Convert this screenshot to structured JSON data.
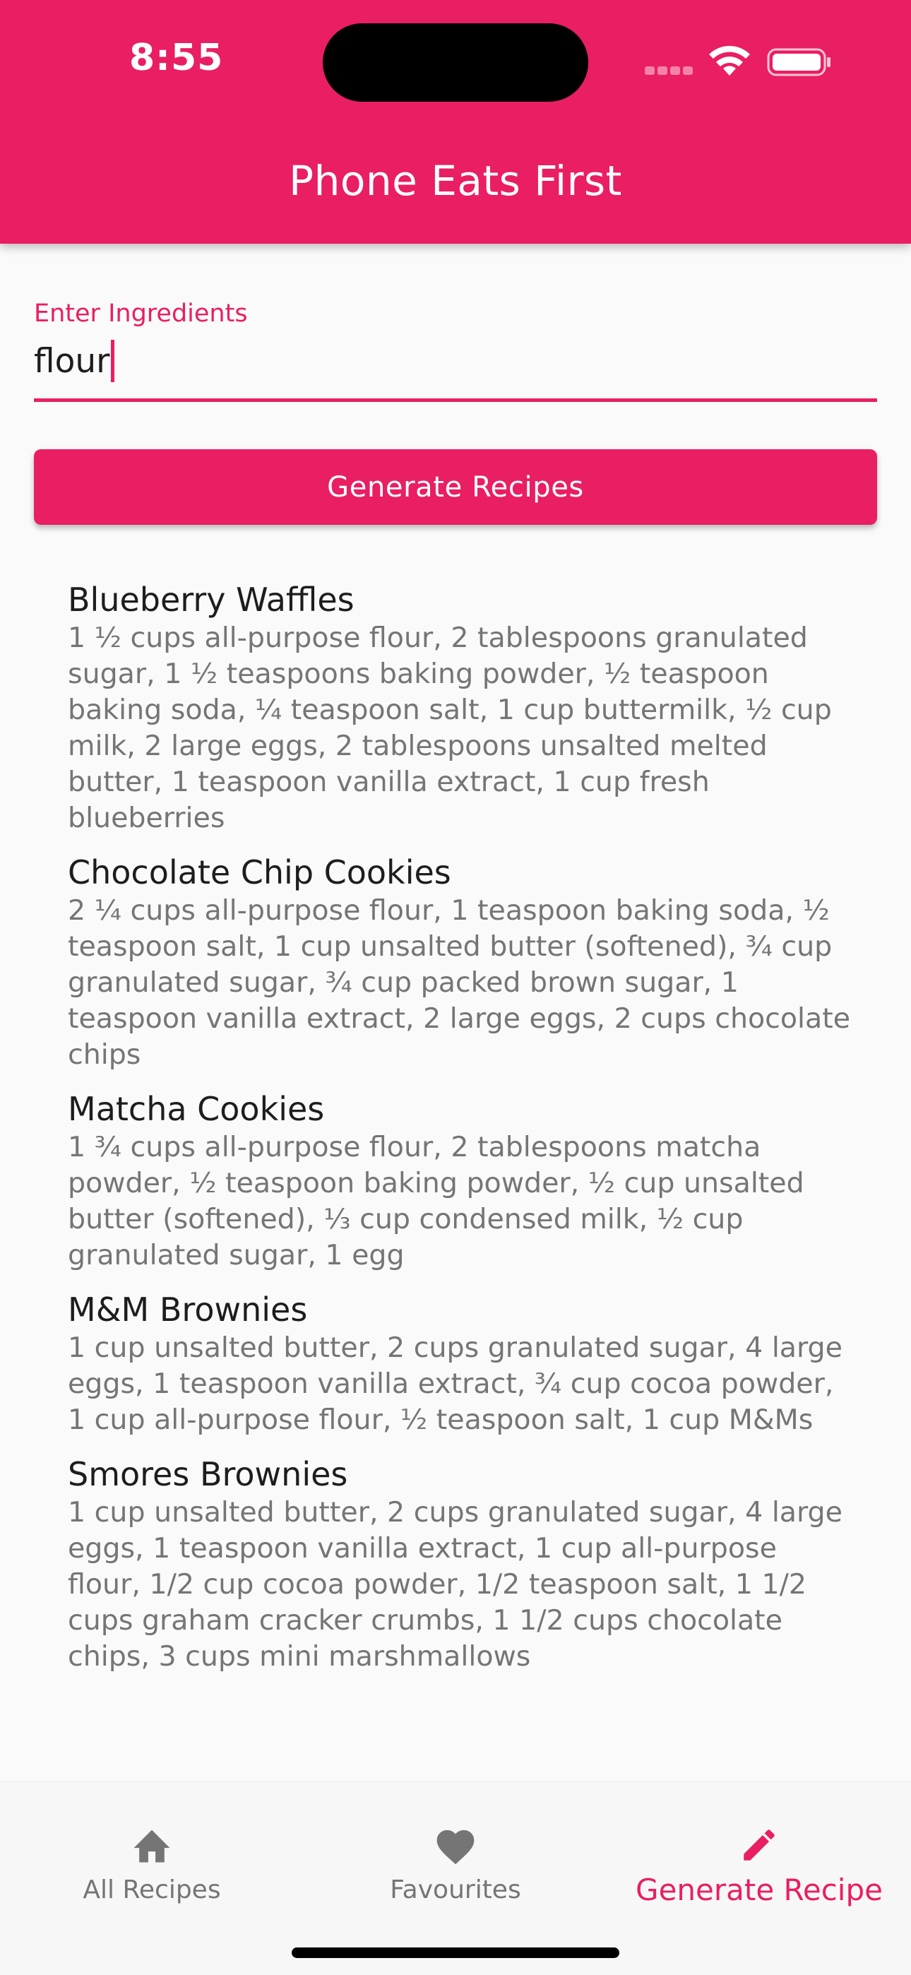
{
  "status_bar": {
    "time": "8:55"
  },
  "app": {
    "title": "Phone Eats First",
    "accent_color": "#e91e63"
  },
  "ingredients_field": {
    "label": "Enter Ingredients",
    "value": "flour"
  },
  "generate_button": {
    "label": "Generate Recipes"
  },
  "recipes": [
    {
      "title": "Blueberry Waffles",
      "ingredients": "1 ½ cups all-purpose flour, 2 tablespoons granulated sugar, 1 ½ teaspoons baking powder, ½ teaspoon baking soda, ¼ teaspoon salt, 1 cup buttermilk, ½ cup milk, 2 large eggs, 2 tablespoons unsalted melted butter, 1 teaspoon vanilla extract, 1 cup fresh blueberries"
    },
    {
      "title": "Chocolate Chip Cookies",
      "ingredients": "2 ¼ cups all-purpose flour, 1 teaspoon baking soda, ½ teaspoon salt, 1 cup unsalted butter (softened), ¾ cup granulated sugar, ¾ cup packed brown sugar, 1 teaspoon vanilla extract, 2 large eggs, 2 cups chocolate chips"
    },
    {
      "title": "Matcha Cookies",
      "ingredients": "1 ¾ cups all-purpose flour, 2 tablespoons matcha powder, ½ teaspoon baking powder, ½ cup unsalted butter (softened), ⅓ cup condensed milk, ½ cup granulated sugar, 1 egg"
    },
    {
      "title": "M&M Brownies",
      "ingredients": "1 cup unsalted butter, 2 cups granulated sugar, 4 large eggs, 1 teaspoon vanilla extract, ¾ cup cocoa powder, 1 cup all-purpose flour, ½ teaspoon salt, 1 cup M&Ms"
    },
    {
      "title": "Smores Brownies",
      "ingredients": "1 cup unsalted butter, 2 cups granulated sugar, 4 large eggs, 1 teaspoon vanilla extract, 1 cup all-purpose flour, 1/2 cup cocoa powder, 1/2 teaspoon salt, 1 1/2 cups graham cracker crumbs, 1 1/2 cups chocolate chips, 3 cups mini marshmallows"
    }
  ],
  "bottom_nav": {
    "items": [
      {
        "label": "All Recipes",
        "icon": "home-icon",
        "active": false
      },
      {
        "label": "Favourites",
        "icon": "heart-icon",
        "active": false
      },
      {
        "label": "Generate Recipe",
        "icon": "pencil-icon",
        "active": true
      }
    ]
  }
}
